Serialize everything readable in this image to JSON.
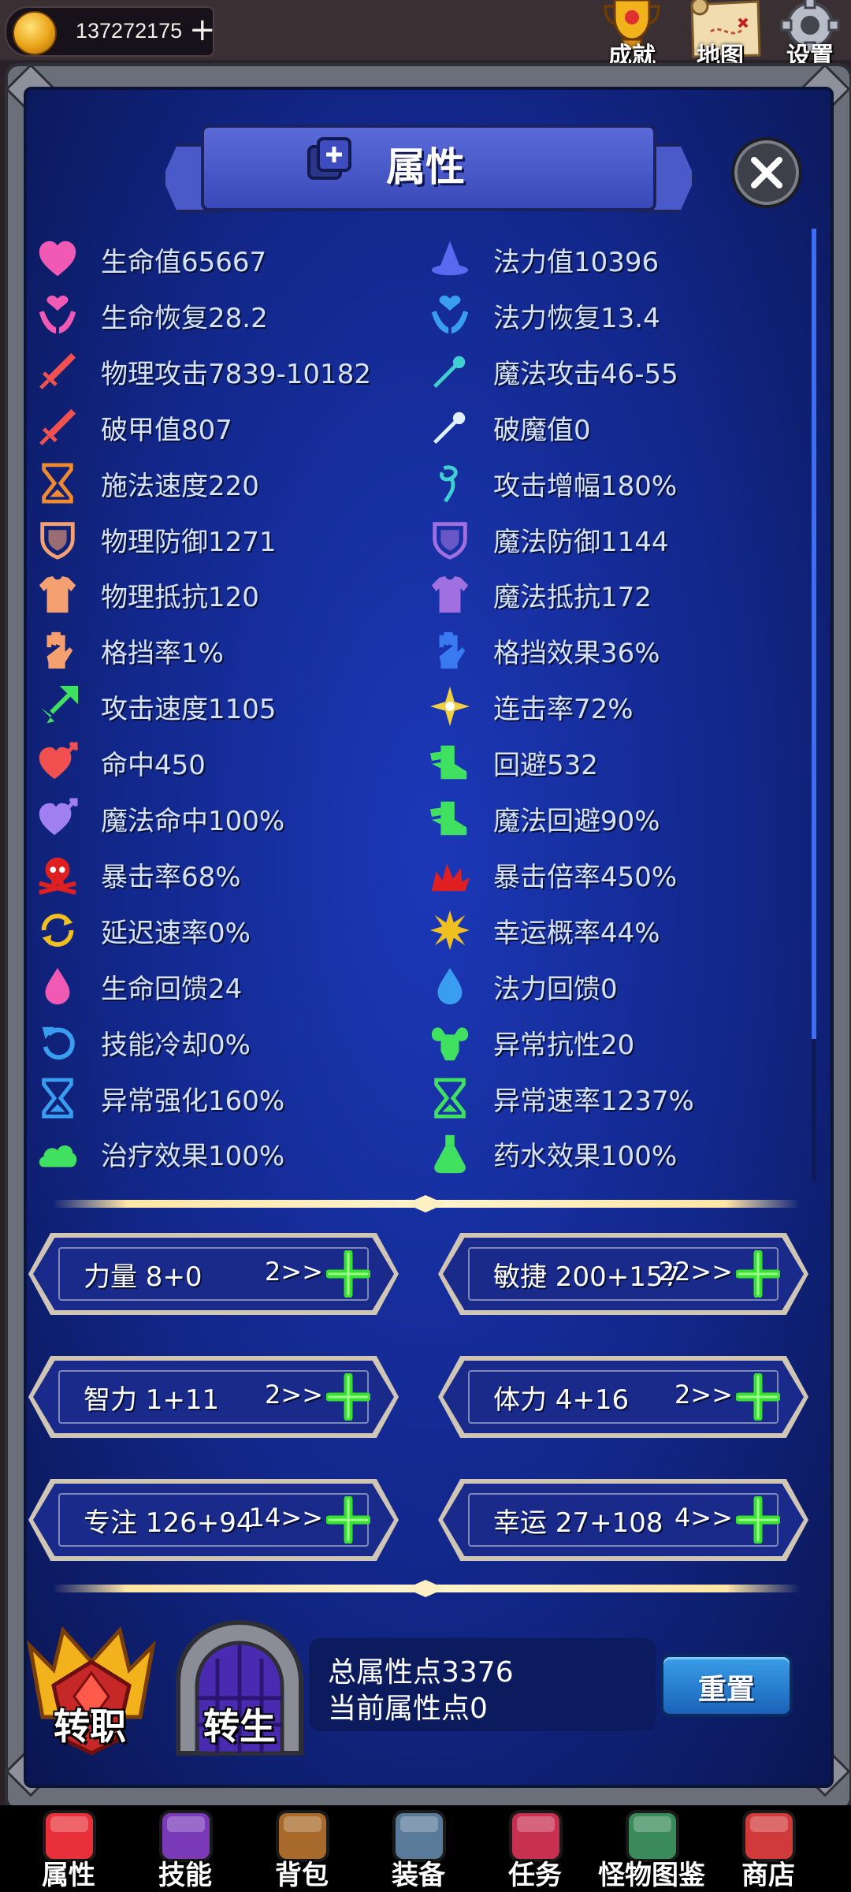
{
  "topbar": {
    "gold": "137272175",
    "achievement_label": "成就",
    "map_label": "地图",
    "settings_label": "设置"
  },
  "panel": {
    "title": "属性"
  },
  "stats_left": [
    {
      "text": "生命值65667",
      "icon": "heart-icon",
      "color": "#f05ab4"
    },
    {
      "text": "生命恢复28.2",
      "icon": "hands-heart-icon",
      "color": "#f05ab4"
    },
    {
      "text": "物理攻击7839-10182",
      "icon": "sword-icon",
      "color": "#f05050"
    },
    {
      "text": "破甲值807",
      "icon": "sword-icon",
      "color": "#f05050"
    },
    {
      "text": "施法速度220",
      "icon": "hourglass-icon",
      "color": "#f08a30"
    },
    {
      "text": "物理防御1271",
      "icon": "shield-icon",
      "color": "#f5a070"
    },
    {
      "text": "物理抵抗120",
      "icon": "armor-icon",
      "color": "#f5a070"
    },
    {
      "text": "格挡率1%",
      "icon": "glove-icon",
      "color": "#f5a070"
    },
    {
      "text": "攻击速度1105",
      "icon": "lightning-arrow-icon",
      "color": "#40e060"
    },
    {
      "text": "命中450",
      "icon": "heart-arrow-icon",
      "color": "#f05050"
    },
    {
      "text": "魔法命中100%",
      "icon": "heart-arrow-icon",
      "color": "#a080f0"
    },
    {
      "text": "暴击率68%",
      "icon": "skull-icon",
      "color": "#e02020"
    },
    {
      "text": "延迟速率0%",
      "icon": "cycle-icon",
      "color": "#f0c020"
    },
    {
      "text": "生命回馈24",
      "icon": "drop-icon",
      "color": "#f05ab4"
    },
    {
      "text": "技能冷却0%",
      "icon": "undo-icon",
      "color": "#3a9ef0"
    },
    {
      "text": "异常强化160%",
      "icon": "hourglass-icon",
      "color": "#3a9ef0"
    },
    {
      "text": "治疗效果100%",
      "icon": "cloud-icon",
      "color": "#40e060"
    }
  ],
  "stats_right": [
    {
      "text": "法力值10396",
      "icon": "wizard-hat-icon",
      "color": "#5a6af0"
    },
    {
      "text": "法力恢复13.4",
      "icon": "hands-heart-icon",
      "color": "#3a9ef0"
    },
    {
      "text": "魔法攻击46-55",
      "icon": "wand-icon",
      "color": "#40d0d0"
    },
    {
      "text": "破魔值0",
      "icon": "wand-icon",
      "color": "#e0f0ff"
    },
    {
      "text": "攻击增幅180%",
      "icon": "swirl-icon",
      "color": "#40d0d0"
    },
    {
      "text": "魔法防御1144",
      "icon": "shield-icon",
      "color": "#a070e0"
    },
    {
      "text": "魔法抵抗172",
      "icon": "armor-icon",
      "color": "#a070e0"
    },
    {
      "text": "格挡效果36%",
      "icon": "glove-icon",
      "color": "#3a7af0"
    },
    {
      "text": "连击率72%",
      "icon": "sparkle-icon",
      "color": "#f0d040"
    },
    {
      "text": "回避532",
      "icon": "winged-boot-icon",
      "color": "#40e060"
    },
    {
      "text": "魔法回避90%",
      "icon": "winged-boot-icon",
      "color": "#40e060"
    },
    {
      "text": "暴击倍率450%",
      "icon": "burst-icon",
      "color": "#e02020"
    },
    {
      "text": "幸运概率44%",
      "icon": "star-burst-icon",
      "color": "#f0c020"
    },
    {
      "text": "法力回馈0",
      "icon": "drop-icon",
      "color": "#3a9ef0"
    },
    {
      "text": "异常抗性20",
      "icon": "muscle-icon",
      "color": "#40e060"
    },
    {
      "text": "异常速率1237%",
      "icon": "hourglass-icon",
      "color": "#40e060"
    },
    {
      "text": "药水效果100%",
      "icon": "potion-icon",
      "color": "#40e060"
    }
  ],
  "attributes": [
    {
      "name": "力量 8+0",
      "cost": "2>>"
    },
    {
      "name": "敏捷 200+157",
      "cost": "22>>"
    },
    {
      "name": "智力 1+11",
      "cost": "2>>"
    },
    {
      "name": "体力 4+16",
      "cost": "2>>"
    },
    {
      "name": "专注 126+94",
      "cost": "14>>"
    },
    {
      "name": "幸运 27+108",
      "cost": "4>>"
    }
  ],
  "bottom": {
    "job_change_label": "转职",
    "rebirth_label": "转生",
    "total_points": "总属性点3376",
    "current_points": "当前属性点0",
    "reset_label": "重置"
  },
  "nav": [
    {
      "label": "属性",
      "icon": "heart-icon"
    },
    {
      "label": "技能",
      "icon": "spellbook-icon"
    },
    {
      "label": "背包",
      "icon": "backpack-icon"
    },
    {
      "label": "装备",
      "icon": "helmet-icon"
    },
    {
      "label": "任务",
      "icon": "scroll-icon"
    },
    {
      "label": "怪物图鉴",
      "icon": "book-icon"
    },
    {
      "label": "商店",
      "icon": "shop-icon"
    }
  ],
  "colors": {
    "panel_blue": "#12278a",
    "plus_green": "#38e030",
    "reset_blue": "#1a62b8"
  }
}
